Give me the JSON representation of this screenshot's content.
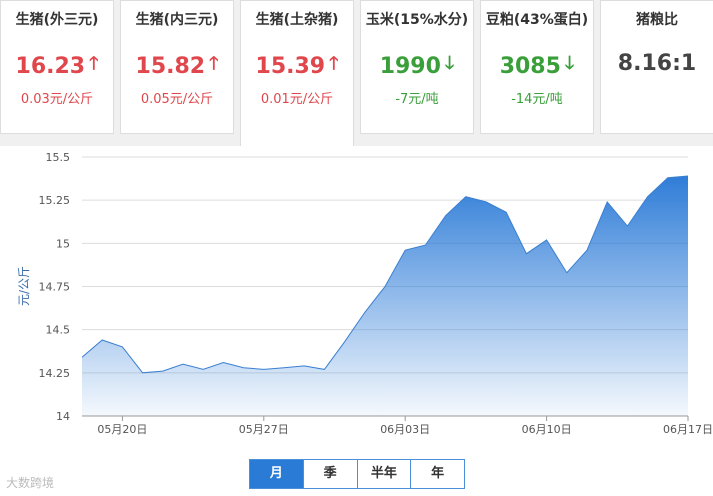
{
  "cards": [
    {
      "title": "生猪(外三元)",
      "price": "16.23",
      "dir": "up",
      "change": "0.03元/公斤"
    },
    {
      "title": "生猪(内三元)",
      "price": "15.82",
      "dir": "up",
      "change": "0.05元/公斤"
    },
    {
      "title": "生猪(土杂猪)",
      "price": "15.39",
      "dir": "up",
      "change": "0.01元/公斤"
    },
    {
      "title": "玉米(15%水分)",
      "price": "1990",
      "dir": "down",
      "change": "-7元/吨"
    },
    {
      "title": "豆粕(43%蛋白)",
      "price": "3085",
      "dir": "down",
      "change": "-14元/吨"
    },
    {
      "title": "猪粮比",
      "price": "8.16:1",
      "dir": "none",
      "change": ""
    }
  ],
  "icons": {
    "up": "arrow-up-icon",
    "down": "arrow-down-icon"
  },
  "colors": {
    "up": "#e0474c",
    "down": "#3a9e3a",
    "accent": "#2a7bd6"
  },
  "period_buttons": [
    "月",
    "季",
    "半年",
    "年"
  ],
  "active_period": "月",
  "watermark": "大数跨境",
  "chart_data": {
    "type": "area",
    "ylabel": "元/公斤",
    "ylim": [
      14,
      15.5
    ],
    "yticks": [
      "15.5",
      "15.25",
      "15",
      "14.75",
      "14.5",
      "14.25",
      "14"
    ],
    "xticks": [
      "05月20日",
      "05月27日",
      "06月03日",
      "06月10日",
      "06月17日"
    ],
    "x": [
      "05-18",
      "05-19",
      "05-20",
      "05-21",
      "05-22",
      "05-23",
      "05-24",
      "05-25",
      "05-26",
      "05-27",
      "05-28",
      "05-29",
      "05-30",
      "05-31",
      "06-01",
      "06-02",
      "06-03",
      "06-04",
      "06-05",
      "06-06",
      "06-07",
      "06-08",
      "06-09",
      "06-10",
      "06-11",
      "06-12",
      "06-13",
      "06-14",
      "06-15",
      "06-16",
      "06-17"
    ],
    "series": [
      {
        "values": [
          14.34,
          14.44,
          14.4,
          14.25,
          14.26,
          14.3,
          14.27,
          14.31,
          14.28,
          14.27,
          14.28,
          14.29,
          14.27,
          14.43,
          14.6,
          14.75,
          14.96,
          14.99,
          15.16,
          15.27,
          15.24,
          15.18,
          14.94,
          15.02,
          14.83,
          14.96,
          15.24,
          15.1,
          15.27,
          15.38,
          15.39
        ]
      }
    ]
  }
}
